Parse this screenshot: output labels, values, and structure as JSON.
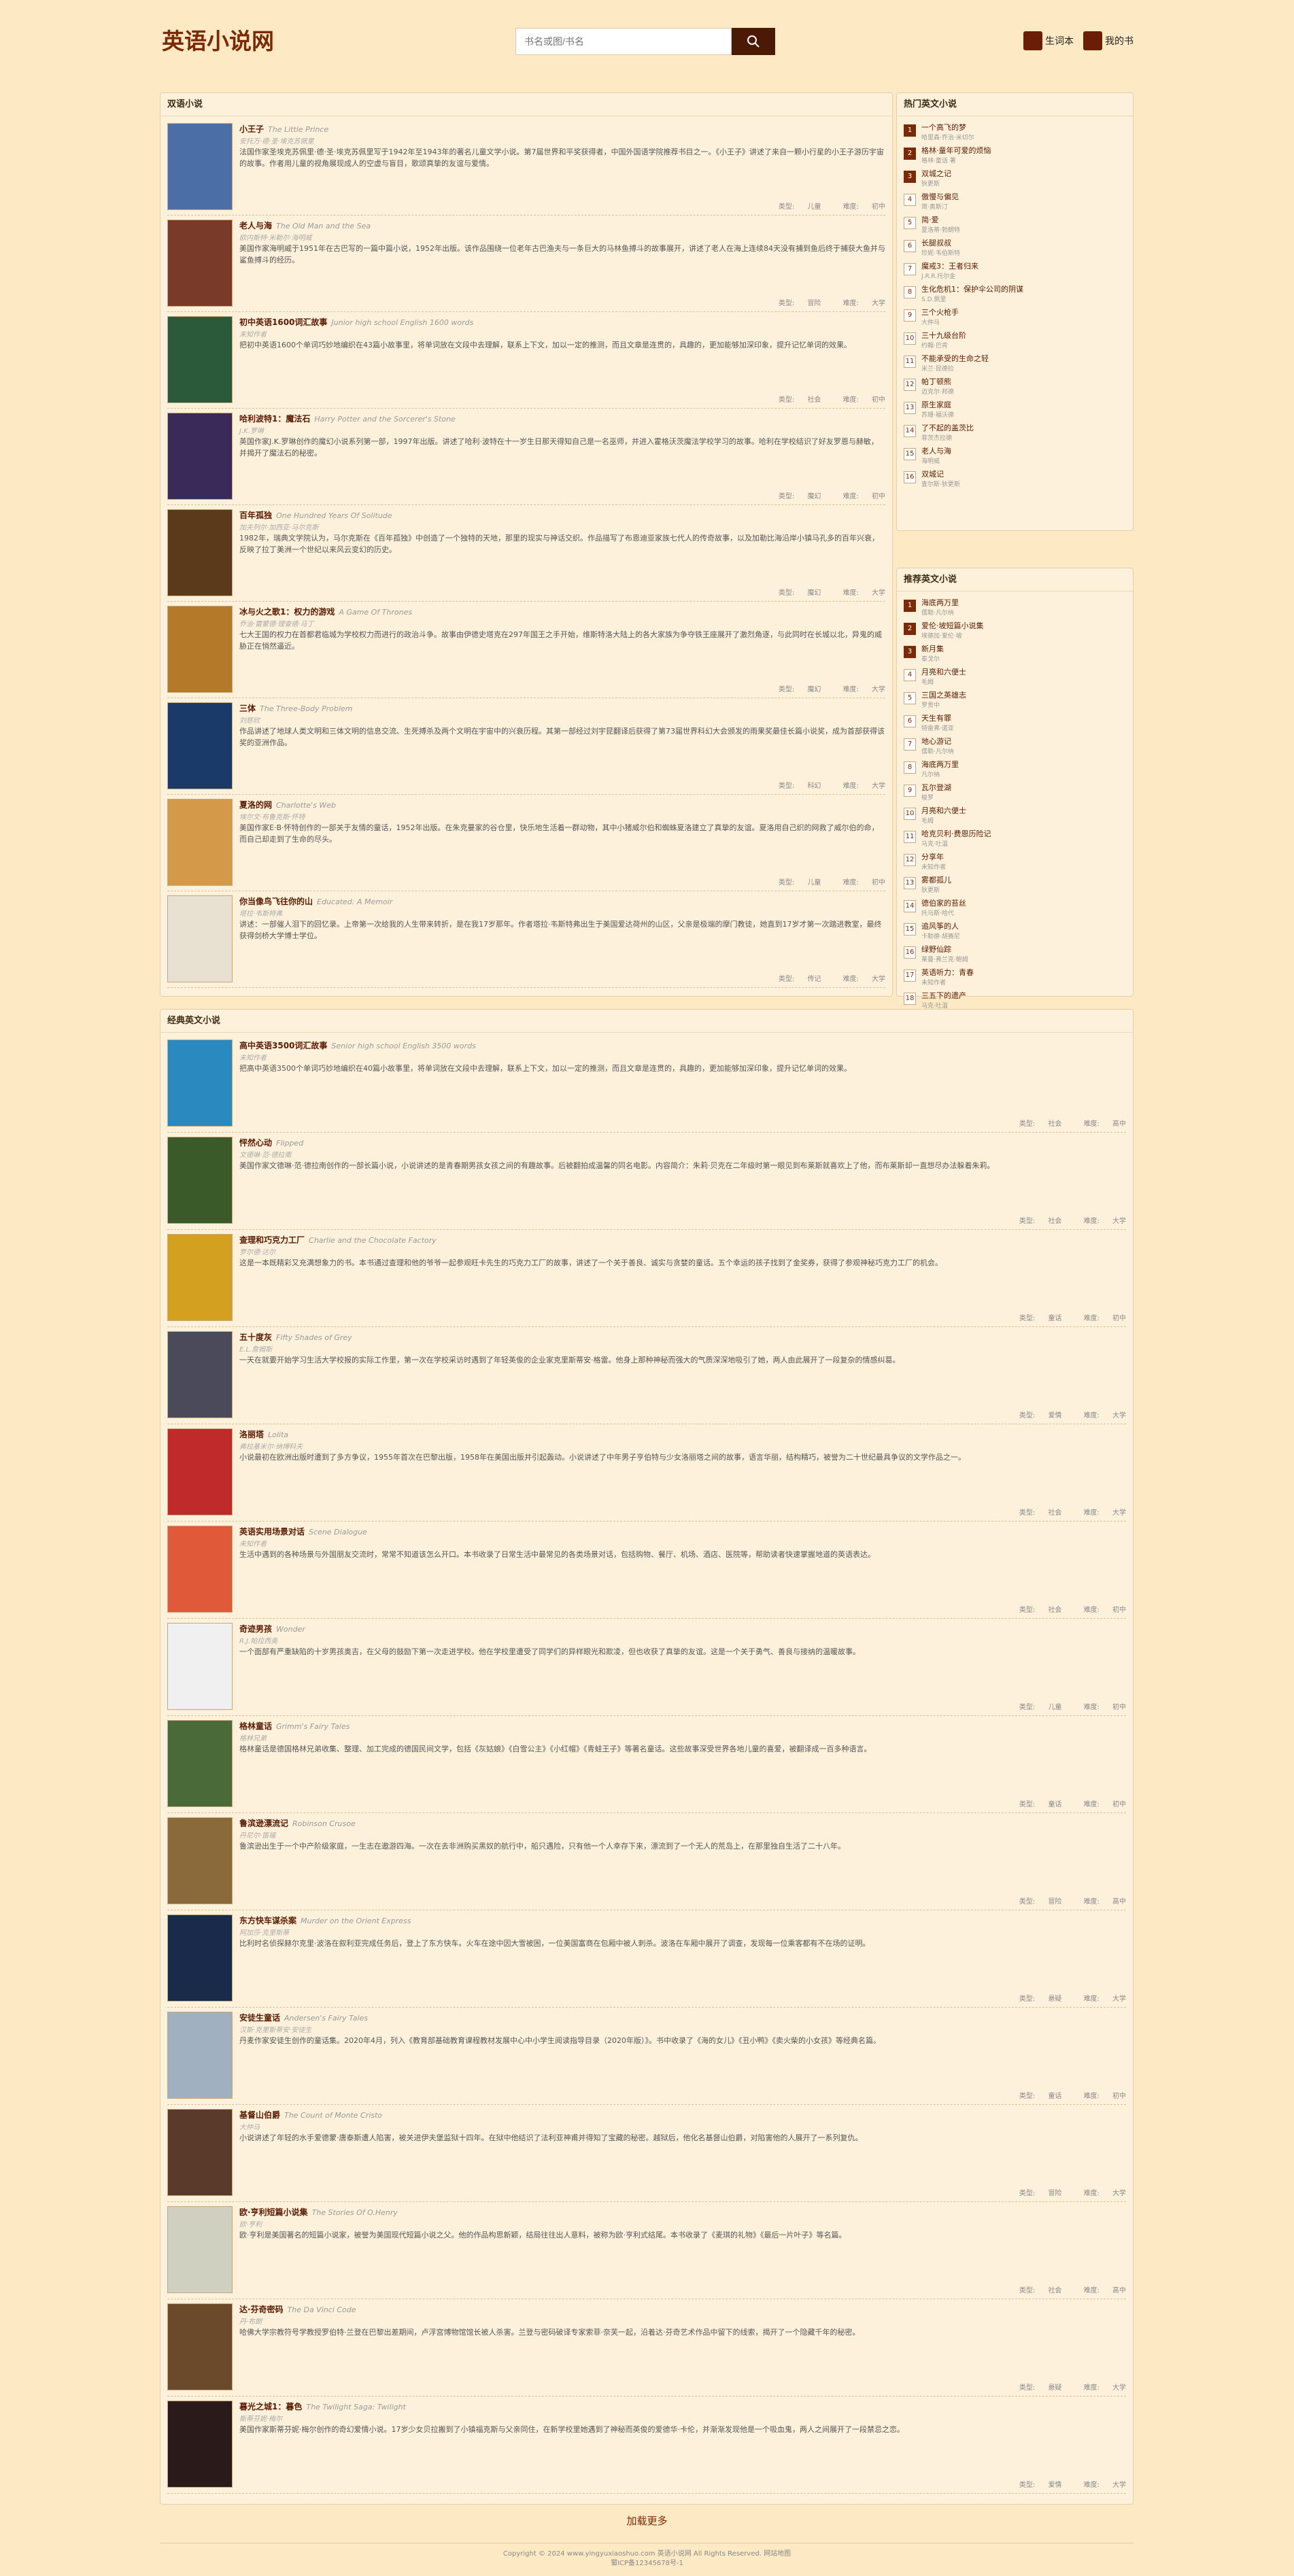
{
  "site": {
    "logo": "英语小说网",
    "search_placeholder": "书名或图/书名",
    "nav": [
      {
        "label": "生词本",
        "icon": "book-icon"
      },
      {
        "label": "我的书",
        "icon": "shelf-icon"
      }
    ]
  },
  "sections": {
    "shuang": "双语小说",
    "hot": "热门英文小说",
    "recommend": "推荐英文小说",
    "classic": "经典英文小说"
  },
  "meta_labels": {
    "type": "类型:",
    "difficulty": "难度:"
  },
  "shuang_books": [
    {
      "cn": "小王子",
      "en": "The Little Prince",
      "author": "安托万·德·圣·埃克苏佩里",
      "desc": "法国作家圣埃克苏佩里·德·圣·埃克苏佩里写于1942年至1943年的著名儿童文学小说。第7届世界和平奖获得者，中国外国语学院推荐书目之一。《小王子》讲述了来自一颗小行星的小王子游历宇宙的故事。作者用儿童的视角展现成人的空虚与盲目，歌颂真挚的友谊与爱情。",
      "type": "儿童",
      "level": "初中",
      "color": "#4a6ea5"
    },
    {
      "cn": "老人与海",
      "en": "The Old Man and the Sea",
      "author": "欧内斯特·米勒尔·海明威",
      "desc": "美国作家海明威于1951年在古巴写的一篇中篇小说，1952年出版。该作品围绕一位老年古巴渔夫与一条巨大的马林鱼搏斗的故事展开，讲述了老人在海上连续84天没有捕到鱼后终于捕获大鱼并与鲨鱼搏斗的经历。",
      "type": "冒险",
      "level": "大学",
      "color": "#7a3a2a"
    },
    {
      "cn": "初中英语1600词汇故事",
      "en": "Junior high school English 1600 words",
      "author": "未知作者",
      "desc": "把初中英语1600个单词巧妙地编织在43篇小故事里，将单词放在文段中去理解，联系上下文，加以一定的推测，而且文章是连贯的，具趣的，更加能够加深印象，提升记忆单词的效果。",
      "type": "社会",
      "level": "初中",
      "color": "#2a5a3a"
    },
    {
      "cn": "哈利波特1：魔法石",
      "en": "Harry Potter and the Sorcerer's Stone",
      "author": "J.K.罗琳",
      "desc": "英国作家J.K.罗琳创作的魔幻小说系列第一部，1997年出版。讲述了哈利·波特在十一岁生日那天得知自己是一名巫师，并进入霍格沃茨魔法学校学习的故事。哈利在学校结识了好友罗恩与赫敏，并揭开了魔法石的秘密。",
      "type": "魔幻",
      "level": "初中",
      "color": "#3a2a5a"
    },
    {
      "cn": "百年孤独",
      "en": "One Hundred Years Of Solitude",
      "author": "加夫列尔·加西亚·马尔克斯",
      "desc": "1982年，瑞典文学院认为，马尔克斯在《百年孤独》中创造了一个独特的天地，那里的现实与神话交织。作品描写了布恩迪亚家族七代人的传奇故事，以及加勒比海沿岸小镇马孔多的百年兴衰，反映了拉丁美洲一个世纪以来风云变幻的历史。",
      "type": "魔幻",
      "level": "大学",
      "color": "#5a3a1a"
    },
    {
      "cn": "冰与火之歌1：权力的游戏",
      "en": "A Game Of Thrones",
      "author": "乔治·雷蒙德·理查德·马丁",
      "desc": "七大王国的权力在首都君临城为学校权力而进行的政治斗争。故事由伊德史塔克在297年国王之手开始，维斯特洛大陆上的各大家族为争夺铁王座展开了激烈角逐，与此同时在长城以北，异鬼的威胁正在悄然逼近。",
      "type": "魔幻",
      "level": "大学",
      "color": "#b47a2a"
    },
    {
      "cn": "三体",
      "en": "The Three-Body Problem",
      "author": "刘慈欣",
      "desc": "作品讲述了地球人类文明和三体文明的信息交流、生死搏杀及两个文明在宇宙中的兴衰历程。其第一部经过刘宇昆翻译后获得了第73届世界科幻大会颁发的雨果奖最佳长篇小说奖，成为首部获得该奖的亚洲作品。",
      "type": "科幻",
      "level": "大学",
      "color": "#1a3a6a"
    },
    {
      "cn": "夏洛的网",
      "en": "Charlotte's Web",
      "author": "埃尔文·布鲁克斯·怀特",
      "desc": "美国作家E·B·怀特创作的一部关于友情的童话，1952年出版。在朱克曼家的谷仓里，快乐地生活着一群动物，其中小猪威尔伯和蜘蛛夏洛建立了真挚的友谊。夏洛用自己织的网救了威尔伯的命，而自己却走到了生命的尽头。",
      "type": "儿童",
      "level": "初中",
      "color": "#d49a4a"
    },
    {
      "cn": "你当像鸟飞往你的山",
      "en": "Educated: A Memoir",
      "author": "塔拉·韦斯特弗",
      "desc": "讲述：一部催人泪下的回忆录。上帝第一次给我的人生带来转折，是在我17岁那年。作者塔拉·韦斯特弗出生于美国爱达荷州的山区，父亲是极端的摩门教徒，她直到17岁才第一次踏进教室，最终获得剑桥大学博士学位。",
      "type": "传记",
      "level": "大学",
      "color": "#e8e0d0"
    }
  ],
  "hot_list": [
    {
      "t": "一个高飞的梦",
      "s": "哈里森·乔治·米切尔"
    },
    {
      "t": "格林·童年可爱的烦恼",
      "s": "格林·童话 著"
    },
    {
      "t": "双城之记",
      "s": "狄更斯"
    },
    {
      "t": "傲慢与偏见",
      "s": "简·奥斯汀"
    },
    {
      "t": "简·爱",
      "s": "夏洛蒂·勃朗特"
    },
    {
      "t": "长腿叔叔",
      "s": "珍妮·韦伯斯特"
    },
    {
      "t": "魔戒3：王者归来",
      "s": "J.R.R.托尔金"
    },
    {
      "t": "生化危机1：保护伞公司的阴谋",
      "s": "S.D.佩里"
    },
    {
      "t": "三个火枪手",
      "s": "大仲马"
    },
    {
      "t": "三十九级台阶",
      "s": "约翰·巴肯"
    },
    {
      "t": "不能承受的生命之轻",
      "s": "米兰·昆德拉"
    },
    {
      "t": "帕丁顿熊",
      "s": "迈克尔·邦德"
    },
    {
      "t": "原生家庭",
      "s": "苏珊·福沃德"
    },
    {
      "t": "了不起的盖茨比",
      "s": "菲茨杰拉德"
    },
    {
      "t": "老人与海",
      "s": "海明威"
    },
    {
      "t": "双城记",
      "s": "查尔斯·狄更斯"
    }
  ],
  "rec_list": [
    {
      "t": "海底两万里",
      "s": "儒勒·凡尔纳"
    },
    {
      "t": "爱伦·坡短篇小说集",
      "s": "埃德加·爱伦·坡"
    },
    {
      "t": "新月集",
      "s": "泰戈尔"
    },
    {
      "t": "月亮和六便士",
      "s": "毛姆"
    },
    {
      "t": "三国之英雄志",
      "s": "罗贯中"
    },
    {
      "t": "天生有罪",
      "s": "特雷弗·诺亚"
    },
    {
      "t": "地心游记",
      "s": "儒勒·凡尔纳"
    },
    {
      "t": "海底两万里",
      "s": "凡尔纳"
    },
    {
      "t": "瓦尔登湖",
      "s": "梭罗"
    },
    {
      "t": "月亮和六便士",
      "s": "毛姆"
    },
    {
      "t": "哈克贝利·费恩历险记",
      "s": "马克·吐温"
    },
    {
      "t": "分享年",
      "s": "未知作者"
    },
    {
      "t": "雾都孤儿",
      "s": "狄更斯"
    },
    {
      "t": "德伯家的苔丝",
      "s": "托马斯·哈代"
    },
    {
      "t": "追风筝的人",
      "s": "卡勒德·胡赛尼"
    },
    {
      "t": "绿野仙踪",
      "s": "莱曼·弗兰克·鲍姆"
    },
    {
      "t": "英语听力：青春",
      "s": "未知作者"
    },
    {
      "t": "三五下的遗产",
      "s": "马克·吐温"
    }
  ],
  "classic_books": [
    {
      "cn": "高中英语3500词汇故事",
      "en": "Senior high school English 3500 words",
      "author": "未知作者",
      "desc": "把高中英语3500个单词巧妙地编织在40篇小故事里，将单词放在文段中去理解，联系上下文，加以一定的推测，而且文章是连贯的，具趣的，更加能够加深印象，提升记忆单词的效果。",
      "type": "社会",
      "level": "高中",
      "color": "#2a8ac0"
    },
    {
      "cn": "怦然心动",
      "en": "Flipped",
      "author": "文德琳·范·德拉南",
      "desc": "美国作家文德琳·范·德拉南创作的一部长篇小说，小说讲述的是青春期男孩女孩之间的有趣故事。后被翻拍成温馨的同名电影。内容简介：朱莉·贝克在二年级时第一眼见到布莱斯就喜欢上了他，而布莱斯却一直想尽办法躲着朱莉。",
      "type": "社会",
      "level": "大学",
      "color": "#3a5a2a"
    },
    {
      "cn": "查理和巧克力工厂",
      "en": "Charlie and the Chocolate Factory",
      "author": "罗尔德·达尔",
      "desc": "这是一本既精彩又充满想象力的书。本书通过查理和他的爷爷一起参观旺卡先生的巧克力工厂的故事，讲述了一个关于善良、诚实与贪婪的童话。五个幸运的孩子找到了金奖券，获得了参观神秘巧克力工厂的机会。",
      "type": "童话",
      "level": "初中",
      "color": "#d4a020"
    },
    {
      "cn": "五十度灰",
      "en": "Fifty Shades of Grey",
      "author": "E.L.詹姆斯",
      "desc": "一天在就要开始学习生活大学校报的实际工作里，第一次在学校采访时遇到了年轻英俊的企业家克里斯蒂安·格雷。他身上那种神秘而强大的气质深深地吸引了她，两人由此展开了一段复杂的情感纠葛。",
      "type": "爱情",
      "level": "大学",
      "color": "#4a4a5a"
    },
    {
      "cn": "洛丽塔",
      "en": "Lolita",
      "author": "弗拉基米尔·纳博科夫",
      "desc": "小说最初在欧洲出版时遭到了多方争议，1955年首次在巴黎出版，1958年在美国出版并引起轰动。小说讲述了中年男子亨伯特与少女洛丽塔之间的故事，语言华丽，结构精巧，被誉为二十世纪最具争议的文学作品之一。",
      "type": "社会",
      "level": "大学",
      "color": "#c02a2a"
    },
    {
      "cn": "英语实用场景对话",
      "en": "Scene Dialogue",
      "author": "未知作者",
      "desc": "生活中遇到的各种场景与外国朋友交流时，常常不知道该怎么开口。本书收录了日常生活中最常见的各类场景对话，包括购物、餐厅、机场、酒店、医院等，帮助读者快速掌握地道的英语表达。",
      "type": "社会",
      "level": "初中",
      "color": "#e05a3a"
    },
    {
      "cn": "奇迹男孩",
      "en": "Wonder",
      "author": "R.J.帕拉西奥",
      "desc": "一个面部有严重缺陷的十岁男孩奥吉，在父母的鼓励下第一次走进学校。他在学校里遭受了同学们的异样眼光和欺凌，但也收获了真挚的友谊。这是一个关于勇气、善良与接纳的温暖故事。",
      "type": "儿童",
      "level": "初中",
      "color": "#f0f0f0"
    },
    {
      "cn": "格林童话",
      "en": "Grimm's Fairy Tales",
      "author": "格林兄弟",
      "desc": "格林童话是德国格林兄弟收集、整理、加工完成的德国民间文学，包括《灰姑娘》《白雪公主》《小红帽》《青蛙王子》等著名童话。这些故事深受世界各地儿童的喜爱，被翻译成一百多种语言。",
      "type": "童话",
      "level": "初中",
      "color": "#4a6a3a"
    },
    {
      "cn": "鲁滨逊漂流记",
      "en": "Robinson Crusoe",
      "author": "丹尼尔·笛福",
      "desc": "鲁滨逊出生于一个中产阶级家庭，一生志在遨游四海。一次在去非洲购买黑奴的航行中，船只遇险，只有他一个人幸存下来，漂流到了一个无人的荒岛上，在那里独自生活了二十八年。",
      "type": "冒险",
      "level": "高中",
      "color": "#8a6a3a"
    },
    {
      "cn": "东方快车谋杀案",
      "en": "Murder on the Orient Express",
      "author": "阿加莎·克里斯蒂",
      "desc": "比利时名侦探赫尔克里·波洛在叙利亚完成任务后，登上了东方快车。火车在途中因大雪被困，一位美国富商在包厢中被人刺杀。波洛在车厢中展开了调查，发现每一位乘客都有不在场的证明。",
      "type": "悬疑",
      "level": "大学",
      "color": "#1a2a4a"
    },
    {
      "cn": "安徒生童话",
      "en": "Andersen's Fairy Tales",
      "author": "汉斯·克里斯蒂安·安徒生",
      "desc": "丹麦作家安徒生创作的童话集。2020年4月，列入《教育部基础教育课程教材发展中心中小学生阅读指导目录（2020年版）》。书中收录了《海的女儿》《丑小鸭》《卖火柴的小女孩》等经典名篇。",
      "type": "童话",
      "level": "初中",
      "color": "#a0b0c0"
    },
    {
      "cn": "基督山伯爵",
      "en": "The Count of Monte Cristo",
      "author": "大仲马",
      "desc": "小说讲述了年轻的水手爱德蒙·唐泰斯遭人陷害，被关进伊夫堡监狱十四年。在狱中他结识了法利亚神甫并得知了宝藏的秘密。越狱后，他化名基督山伯爵，对陷害他的人展开了一系列复仇。",
      "type": "冒险",
      "level": "大学",
      "color": "#5a3a2a"
    },
    {
      "cn": "欧·亨利短篇小说集",
      "en": "The Stories Of O.Henry",
      "author": "欧·亨利",
      "desc": "欧·亨利是美国著名的短篇小说家，被誉为美国现代短篇小说之父。他的作品构思新颖，结局往往出人意料，被称为欧·亨利式结尾。本书收录了《麦琪的礼物》《最后一片叶子》等名篇。",
      "type": "社会",
      "level": "高中",
      "color": "#d0d0c0"
    },
    {
      "cn": "达·芬奇密码",
      "en": "The Da Vinci Code",
      "author": "丹·布朗",
      "desc": "哈佛大学宗教符号学教授罗伯特·兰登在巴黎出差期间，卢浮宫博物馆馆长被人杀害。兰登与密码破译专家索菲·奈芙一起，沿着达·芬奇艺术作品中留下的线索，揭开了一个隐藏千年的秘密。",
      "type": "悬疑",
      "level": "大学",
      "color": "#6a4a2a"
    },
    {
      "cn": "暮光之城1：暮色",
      "en": "The Twilight Saga: Twilight",
      "author": "斯蒂芬妮·梅尔",
      "desc": "美国作家斯蒂芬妮·梅尔创作的奇幻爱情小说。17岁少女贝拉搬到了小镇福克斯与父亲同住，在新学校里她遇到了神秘而英俊的爱德华·卡伦，并渐渐发现他是一个吸血鬼，两人之间展开了一段禁忌之恋。",
      "type": "爱情",
      "level": "大学",
      "color": "#2a1a1a"
    }
  ],
  "load_more": "加载更多",
  "footer": {
    "copyright": "Copyright © 2024 www.yingyuxiaoshuo.com 英语小说网 All Rights Reserved. 网站地图",
    "icp": "蜀ICP备12345678号-1"
  }
}
